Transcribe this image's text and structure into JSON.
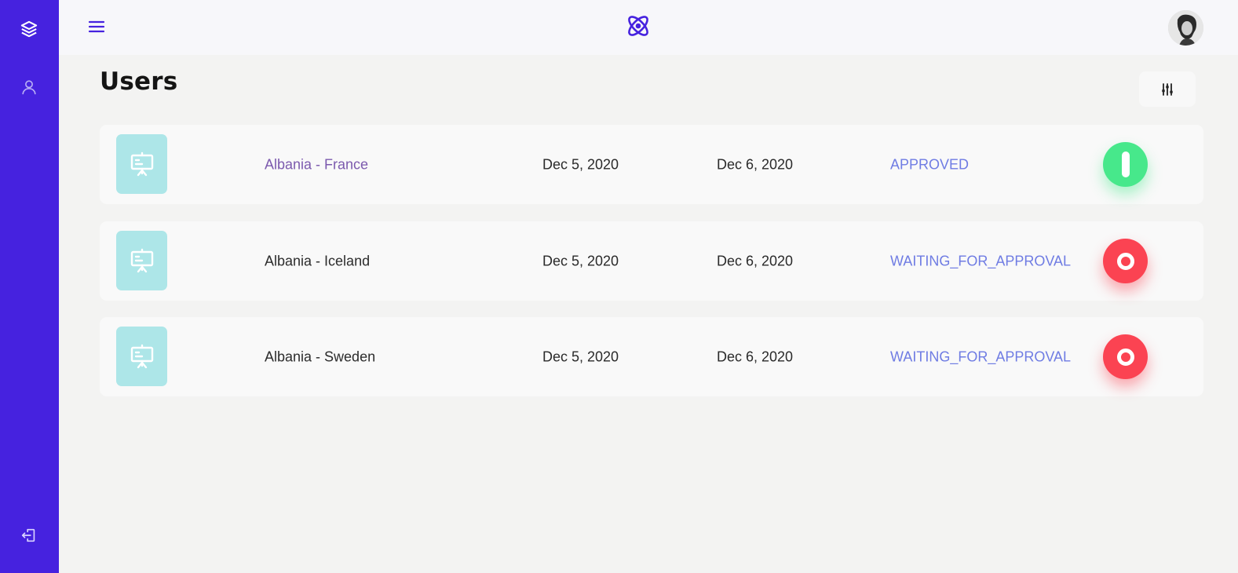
{
  "header": {
    "title": "Users"
  },
  "sidebar": {
    "items": [
      {
        "name": "layers",
        "icon": "layers-icon"
      },
      {
        "name": "user",
        "icon": "user-icon"
      },
      {
        "name": "logout",
        "icon": "logout-icon"
      }
    ]
  },
  "topbar": {
    "menu_icon": "hamburger-icon",
    "logo_icon": "atom-icon",
    "avatar": "user-avatar"
  },
  "filter": {
    "icon": "sliders-icon"
  },
  "rows": [
    {
      "name": "Albania - France",
      "start": "Dec 5, 2020",
      "end": "Dec 6, 2020",
      "status": "APPROVED",
      "enabled": true
    },
    {
      "name": "Albania - Iceland",
      "start": "Dec 5, 2020",
      "end": "Dec 6, 2020",
      "status": "WAITING_FOR_APPROVAL",
      "enabled": false
    },
    {
      "name": "Albania - Sweden",
      "start": "Dec 5, 2020",
      "end": "Dec 6, 2020",
      "status": "WAITING_FOR_APPROVAL",
      "enabled": false
    }
  ],
  "colors": {
    "sidebar": "#4622df",
    "approved_toggle": "#47e88b",
    "waiting_toggle": "#fb4352",
    "status_text": "#6f7ce3",
    "thumb": "#ade6e8"
  }
}
